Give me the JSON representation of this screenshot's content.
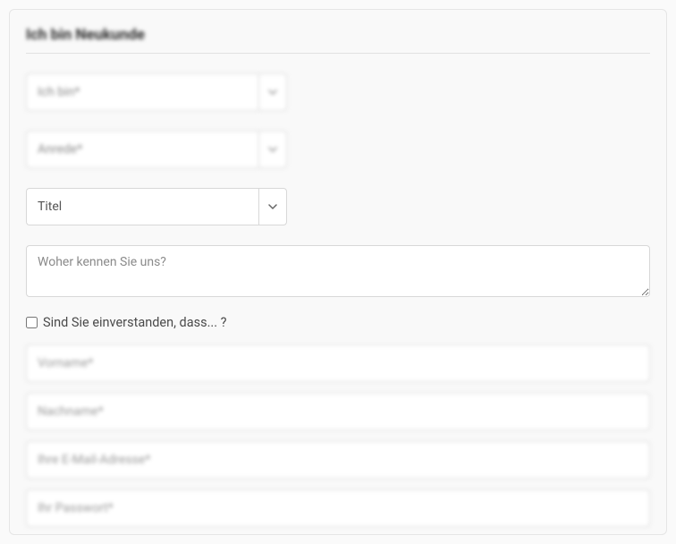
{
  "form": {
    "heading": "Ich bin Neukunde",
    "customer_type": {
      "placeholder": "Ich bin*"
    },
    "salutation": {
      "placeholder": "Anrede*"
    },
    "title": {
      "placeholder": "Titel"
    },
    "how_known": {
      "placeholder": "Woher kennen Sie uns?"
    },
    "consent": {
      "label": "Sind Sie einverstanden, dass... ?"
    },
    "firstname": {
      "placeholder": "Vorname*"
    },
    "lastname": {
      "placeholder": "Nachname*"
    },
    "email": {
      "placeholder": "Ihre E-Mail-Adresse*"
    },
    "password": {
      "placeholder": "Ihr Passwort*"
    }
  }
}
